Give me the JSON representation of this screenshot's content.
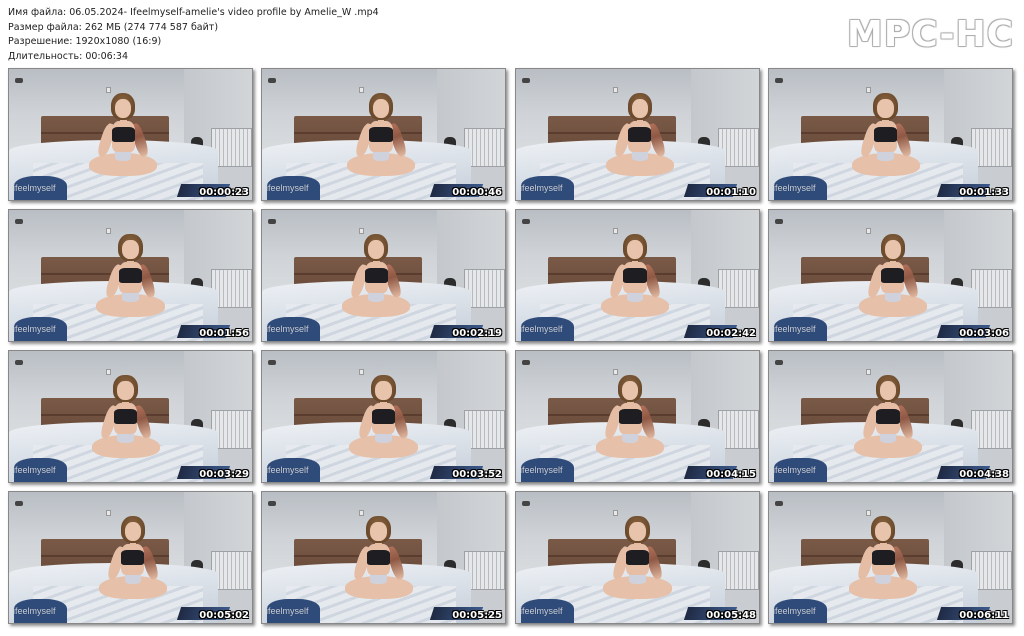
{
  "header": {
    "filename_line": "Имя файла: 06.05.2024- Ifeelmyself-amelie's video profile by Amelie_W .mp4",
    "size_line": "Размер файла: 262 МБ (274 774 587 байт)",
    "resolution_line": "Разрешение: 1920x1080 (16:9)",
    "duration_line": "Длительность: 00:06:34"
  },
  "logo": "MPC-HC",
  "watermark": "ifeelmyself",
  "thumbnails": [
    {
      "time": "00:00:23"
    },
    {
      "time": "00:00:46"
    },
    {
      "time": "00:01:10"
    },
    {
      "time": "00:01:33"
    },
    {
      "time": "00:01:56"
    },
    {
      "time": "00:02:19"
    },
    {
      "time": "00:02:42"
    },
    {
      "time": "00:03:06"
    },
    {
      "time": "00:03:29"
    },
    {
      "time": "00:03:52"
    },
    {
      "time": "00:04:15"
    },
    {
      "time": "00:04:38"
    },
    {
      "time": "00:05:02"
    },
    {
      "time": "00:05:25"
    },
    {
      "time": "00:05:48"
    },
    {
      "time": "00:06:11"
    }
  ],
  "colors": {
    "background": "#ffffff",
    "timestamp": "#ffffff",
    "headboard": "#6a4b3a",
    "bedding": "#dde3ea"
  }
}
